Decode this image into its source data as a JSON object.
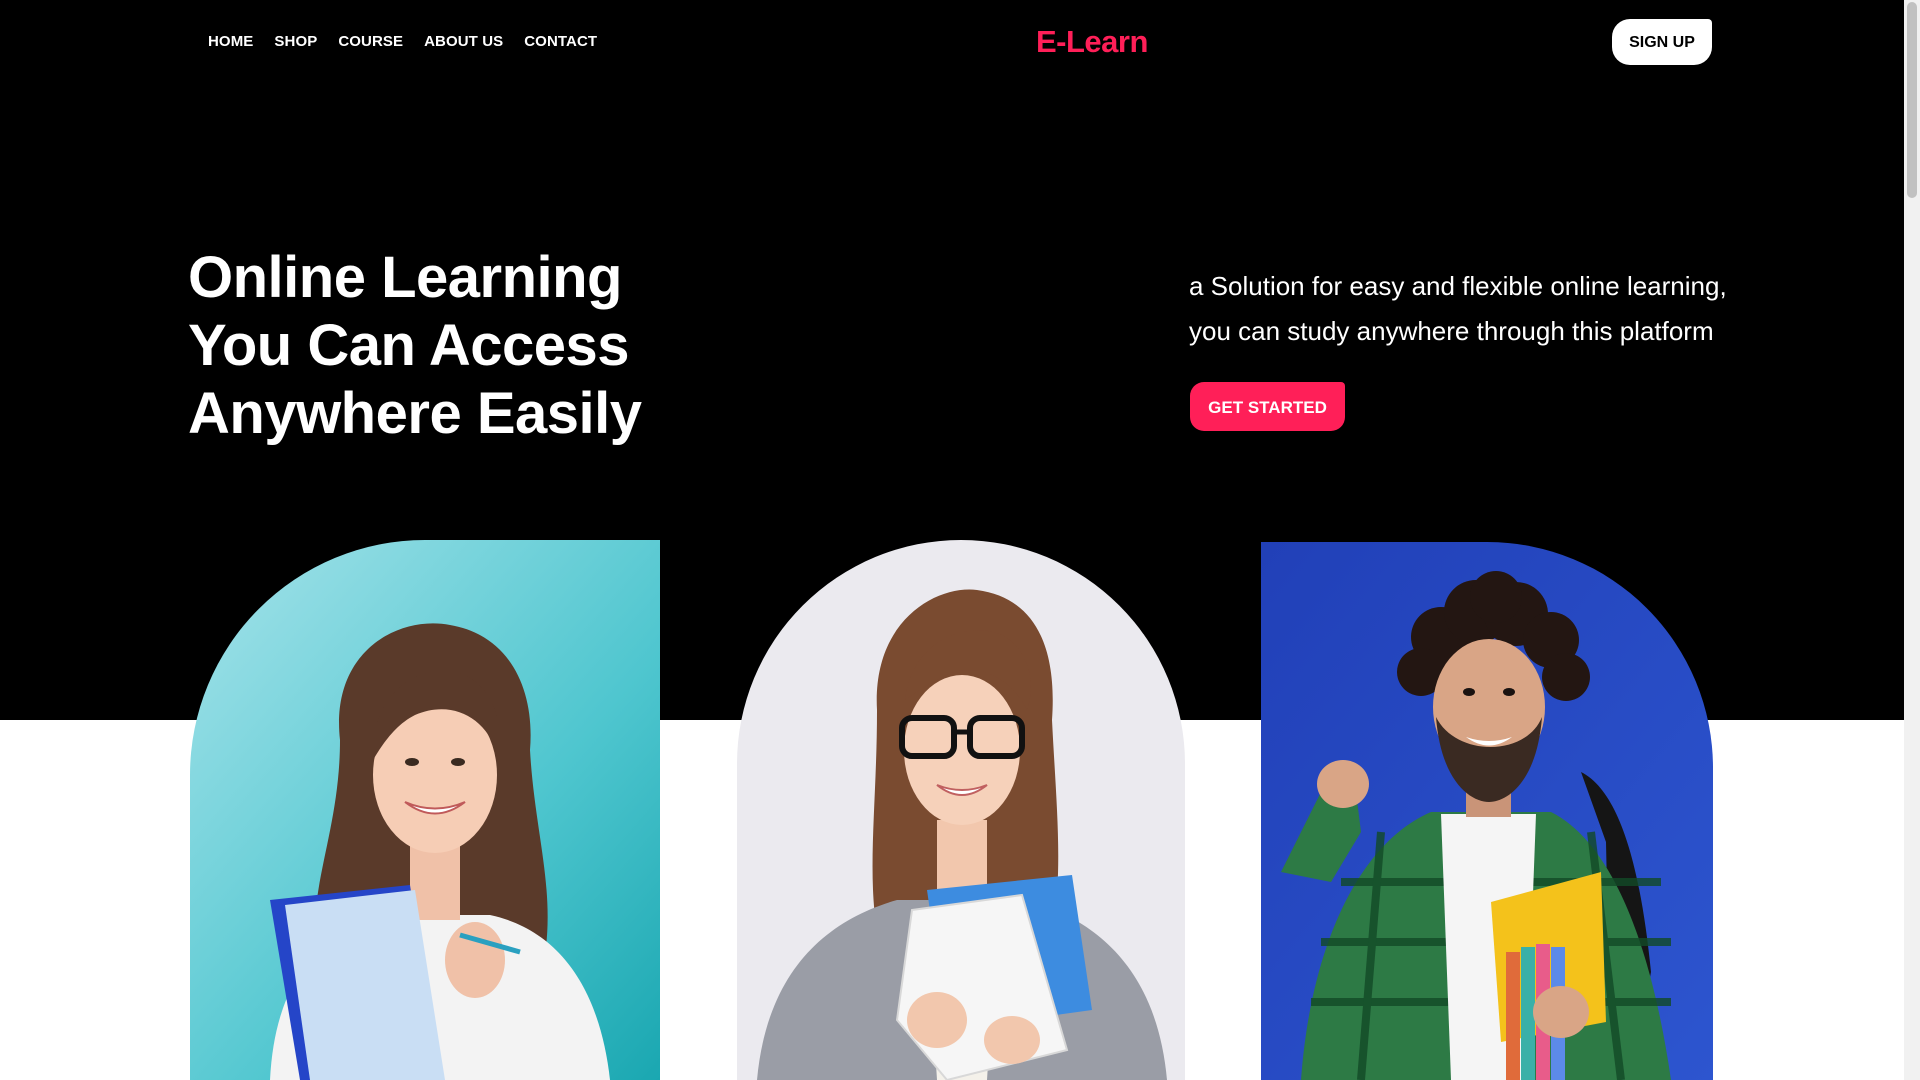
{
  "nav": {
    "items": [
      {
        "label": "HOME"
      },
      {
        "label": "SHOP"
      },
      {
        "label": "COURSE"
      },
      {
        "label": "ABOUT US"
      },
      {
        "label": "CONTACT"
      }
    ]
  },
  "brand": {
    "logo": "E-Learn",
    "accent_color": "#ff1f58"
  },
  "header": {
    "signup_label": "SIGN UP"
  },
  "hero": {
    "headline_lines": [
      "Online Learning",
      "You Can Access",
      "Anywhere Easily"
    ],
    "subtext_lines": [
      "a Solution for easy and flexible online learning,",
      "you can study anywhere through this platform"
    ],
    "cta_label": "GET STARTED"
  },
  "gallery": {
    "cards": [
      {
        "icon": "student-photo-woman-with-notebook",
        "background": "#5fd3dc"
      },
      {
        "icon": "student-photo-woman-with-glasses",
        "background": "#eeeef2"
      },
      {
        "icon": "student-photo-man-with-backpack",
        "background": "#2a4fc4"
      }
    ]
  }
}
